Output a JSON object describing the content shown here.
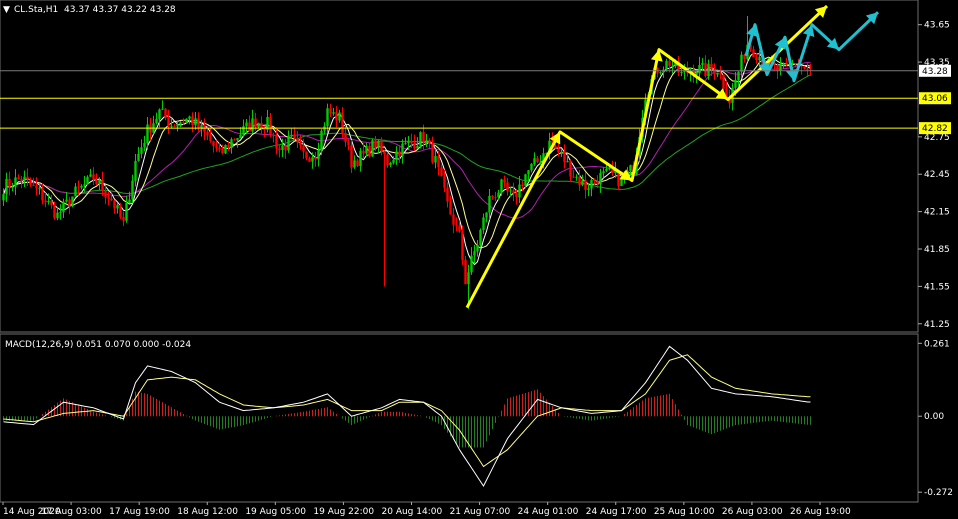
{
  "header": {
    "symbol_label": "CL.Sta,H1",
    "ohlc": "43.37 43.37 43.22 43.28"
  },
  "macd_header": {
    "label": "MACD(12,26,9) 0.051 0.070 0.000 -0.024"
  },
  "colors": {
    "background": "#000000",
    "bull_candle": "#00cc00",
    "bear_candle": "#ff0000",
    "ma_fast": "#ffffff",
    "ma_mid": "#ffff99",
    "ma_purple": "#b020b0",
    "ma_slow": "#20a020",
    "arrows_yellow": "#ffff00",
    "arrows_cyan": "#20c0d0",
    "hline": "#ffff00",
    "macd_pos": "#cc2020",
    "macd_neg": "#208020",
    "macd_line": "#ffffff",
    "signal_line": "#ffff80"
  },
  "chart_data": [
    {
      "type": "candlestick",
      "price_ylim": [
        41.2,
        43.8
      ],
      "y_ticks": [
        "43.65",
        "43.35",
        "42.75",
        "42.45",
        "42.15",
        "41.85",
        "41.55",
        "41.25"
      ],
      "current_price": "43.28",
      "horizontal_levels": [
        "43.06",
        "42.82"
      ],
      "x_tick_labels": [
        "14 Aug 2020",
        "17 Aug 03:00",
        "17 Aug 19:00",
        "18 Aug 12:00",
        "19 Aug 05:00",
        "19 Aug 22:00",
        "20 Aug 14:00",
        "21 Aug 07:00",
        "24 Aug 01:00",
        "24 Aug 17:00",
        "25 Aug 10:00",
        "26 Aug 03:00",
        "26 Aug 19:00"
      ],
      "close_path": [
        [
          0,
          42.35
        ],
        [
          6,
          42.42
        ],
        [
          12,
          42.3
        ],
        [
          18,
          42.12
        ],
        [
          24,
          42.3
        ],
        [
          30,
          42.42
        ],
        [
          36,
          42.25
        ],
        [
          40,
          42.05
        ],
        [
          44,
          42.55
        ],
        [
          48,
          42.8
        ],
        [
          52,
          42.95
        ],
        [
          56,
          42.85
        ],
        [
          62,
          42.9
        ],
        [
          68,
          42.75
        ],
        [
          72,
          42.6
        ],
        [
          76,
          42.72
        ],
        [
          80,
          42.8
        ],
        [
          84,
          42.88
        ],
        [
          88,
          42.85
        ],
        [
          92,
          42.65
        ],
        [
          96,
          42.72
        ],
        [
          100,
          42.6
        ],
        [
          104,
          42.62
        ],
        [
          108,
          42.95
        ],
        [
          112,
          42.9
        ],
        [
          116,
          42.55
        ],
        [
          120,
          42.6
        ],
        [
          124,
          42.7
        ],
        [
          128,
          42.55
        ],
        [
          132,
          42.65
        ],
        [
          136,
          42.7
        ],
        [
          140,
          42.75
        ],
        [
          144,
          42.55
        ],
        [
          148,
          42.2
        ],
        [
          152,
          41.95
        ],
        [
          154,
          41.6
        ],
        [
          158,
          41.9
        ],
        [
          162,
          42.25
        ],
        [
          166,
          42.35
        ],
        [
          170,
          42.25
        ],
        [
          174,
          42.45
        ],
        [
          178,
          42.55
        ],
        [
          182,
          42.7
        ],
        [
          186,
          42.6
        ],
        [
          190,
          42.45
        ],
        [
          194,
          42.35
        ],
        [
          198,
          42.42
        ],
        [
          202,
          42.45
        ],
        [
          206,
          42.4
        ],
        [
          210,
          42.5
        ],
        [
          214,
          43.1
        ],
        [
          218,
          43.3
        ],
        [
          222,
          43.35
        ],
        [
          226,
          43.25
        ],
        [
          230,
          43.3
        ],
        [
          234,
          43.28
        ],
        [
          238,
          43.3
        ],
        [
          242,
          43.05
        ],
        [
          246,
          43.35
        ],
        [
          248,
          43.5
        ],
        [
          252,
          43.4
        ],
        [
          256,
          43.3
        ],
        [
          260,
          43.28
        ],
        [
          264,
          43.35
        ],
        [
          268,
          43.28
        ]
      ],
      "macd_ylim": [
        -0.3,
        0.28
      ],
      "macd_ticks": [
        "0.261",
        "0.00",
        "-0.272"
      ],
      "macd_path": [
        [
          0,
          -0.02
        ],
        [
          10,
          -0.03
        ],
        [
          20,
          0.05
        ],
        [
          30,
          0.03
        ],
        [
          40,
          -0.01
        ],
        [
          44,
          0.12
        ],
        [
          48,
          0.18
        ],
        [
          56,
          0.16
        ],
        [
          64,
          0.12
        ],
        [
          72,
          0.05
        ],
        [
          80,
          0.02
        ],
        [
          90,
          0.03
        ],
        [
          100,
          0.05
        ],
        [
          108,
          0.08
        ],
        [
          116,
          0.0
        ],
        [
          126,
          0.03
        ],
        [
          132,
          0.06
        ],
        [
          140,
          0.05
        ],
        [
          146,
          0.0
        ],
        [
          152,
          -0.12
        ],
        [
          160,
          -0.25
        ],
        [
          168,
          -0.08
        ],
        [
          178,
          0.06
        ],
        [
          186,
          0.03
        ],
        [
          196,
          0.01
        ],
        [
          206,
          0.02
        ],
        [
          214,
          0.12
        ],
        [
          222,
          0.25
        ],
        [
          228,
          0.2
        ],
        [
          236,
          0.1
        ],
        [
          244,
          0.08
        ],
        [
          256,
          0.07
        ],
        [
          268,
          0.051
        ]
      ],
      "signal_path": [
        [
          0,
          -0.01
        ],
        [
          10,
          -0.02
        ],
        [
          20,
          0.01
        ],
        [
          30,
          0.02
        ],
        [
          40,
          0.0
        ],
        [
          48,
          0.13
        ],
        [
          56,
          0.14
        ],
        [
          64,
          0.13
        ],
        [
          72,
          0.08
        ],
        [
          80,
          0.04
        ],
        [
          90,
          0.03
        ],
        [
          100,
          0.04
        ],
        [
          108,
          0.06
        ],
        [
          116,
          0.02
        ],
        [
          126,
          0.02
        ],
        [
          132,
          0.05
        ],
        [
          140,
          0.05
        ],
        [
          146,
          0.02
        ],
        [
          152,
          -0.05
        ],
        [
          160,
          -0.18
        ],
        [
          168,
          -0.12
        ],
        [
          178,
          0.0
        ],
        [
          186,
          0.03
        ],
        [
          196,
          0.02
        ],
        [
          206,
          0.02
        ],
        [
          214,
          0.08
        ],
        [
          222,
          0.2
        ],
        [
          228,
          0.22
        ],
        [
          236,
          0.14
        ],
        [
          244,
          0.1
        ],
        [
          256,
          0.08
        ],
        [
          268,
          0.07
        ]
      ]
    }
  ]
}
